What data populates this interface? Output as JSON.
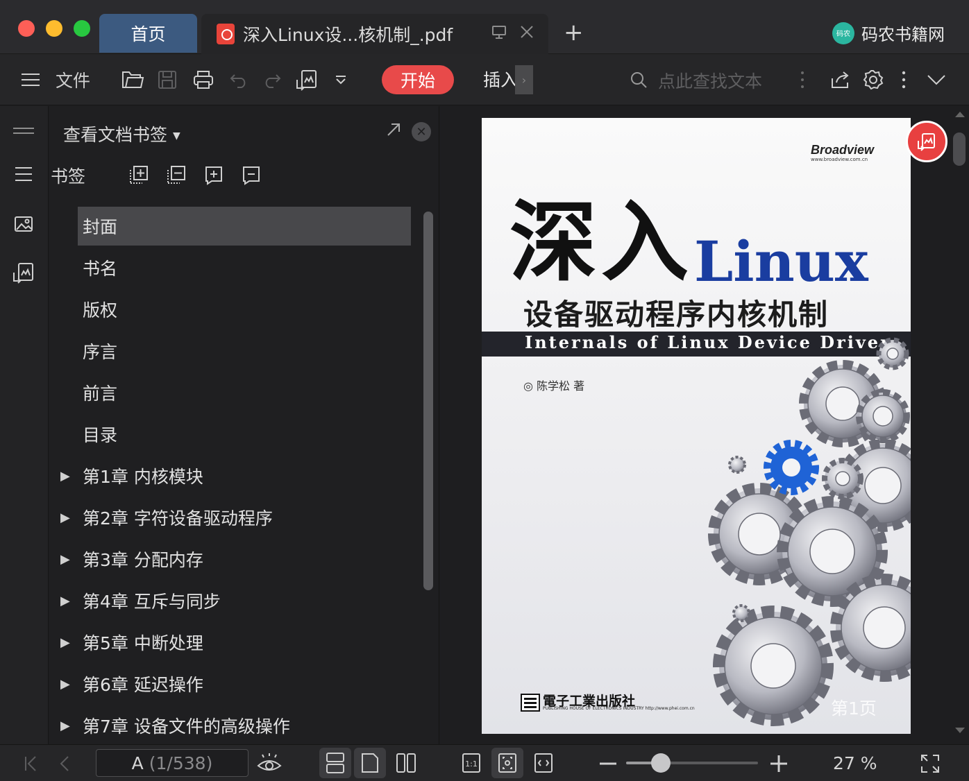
{
  "titlebar": {
    "tabs": [
      {
        "label": "首页"
      },
      {
        "label": "深入Linux设...核机制_.pdf"
      }
    ],
    "new_tab": "+",
    "brand": "码农书籍网",
    "brand_logo_text": "码农"
  },
  "toolbar": {
    "file_label": "文件",
    "start_label": "开始",
    "insert_label": "插入",
    "insert_more": "›",
    "search_placeholder": "点此查找文本"
  },
  "bookmark_panel": {
    "title": "查看文档书签",
    "section_label": "书签",
    "items": [
      {
        "label": "封面",
        "expandable": false,
        "selected": true
      },
      {
        "label": "书名",
        "expandable": false
      },
      {
        "label": "版权",
        "expandable": false
      },
      {
        "label": "序言",
        "expandable": false
      },
      {
        "label": "前言",
        "expandable": false
      },
      {
        "label": "目录",
        "expandable": false
      },
      {
        "label": "第1章 内核模块",
        "expandable": true
      },
      {
        "label": "第2章 字符设备驱动程序",
        "expandable": true
      },
      {
        "label": "第3章 分配内存",
        "expandable": true
      },
      {
        "label": "第4章 互斥与同步",
        "expandable": true
      },
      {
        "label": "第5章 中断处理",
        "expandable": true
      },
      {
        "label": "第6章 延迟操作",
        "expandable": true
      },
      {
        "label": "第7章 设备文件的高级操作",
        "expandable": true
      }
    ]
  },
  "document": {
    "cover": {
      "brand": "Broadview",
      "brand_url": "www.broadview.com.cn",
      "title_cn": "深入",
      "title_linux": "Linux",
      "subtitle": "设备驱动程序内核机制",
      "title_en": "Internals of Linux Device Driver",
      "author": "◎ 陈学松 著",
      "publisher": "電子工業出版社",
      "publisher_en": "PUBLISHING HOUSE OF ELECTRONICS INDUSTRY  http://www.phei.com.cn"
    },
    "page_watermark": "第1页"
  },
  "statusbar": {
    "page_letter": "A",
    "page_info": "(1/538)",
    "zoom_value": "27 %",
    "zoom_fraction": 0.2
  },
  "colors": {
    "accent": "#e84a4a",
    "tab_home": "#3c5a80",
    "background": "#1e1e20",
    "linux_blue": "#1a3da0",
    "gear_blue": "#1f63d6"
  }
}
